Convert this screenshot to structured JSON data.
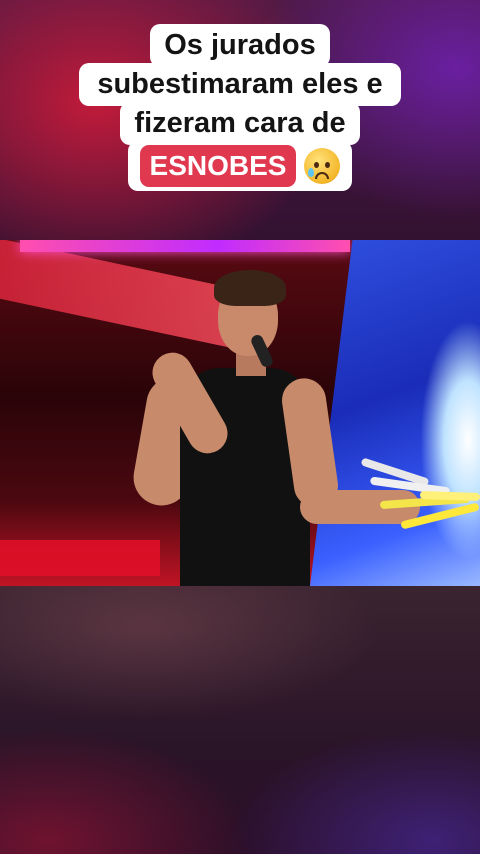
{
  "caption": {
    "line1": "Os jurados",
    "line2": "subestimaram eles e",
    "line3": "fizeram cara de",
    "highlight": "ESNOBES",
    "emoji": "sad-but-relieved-face"
  },
  "colors": {
    "highlight_bg": "#e0394f",
    "caption_bg": "#ffffff"
  }
}
